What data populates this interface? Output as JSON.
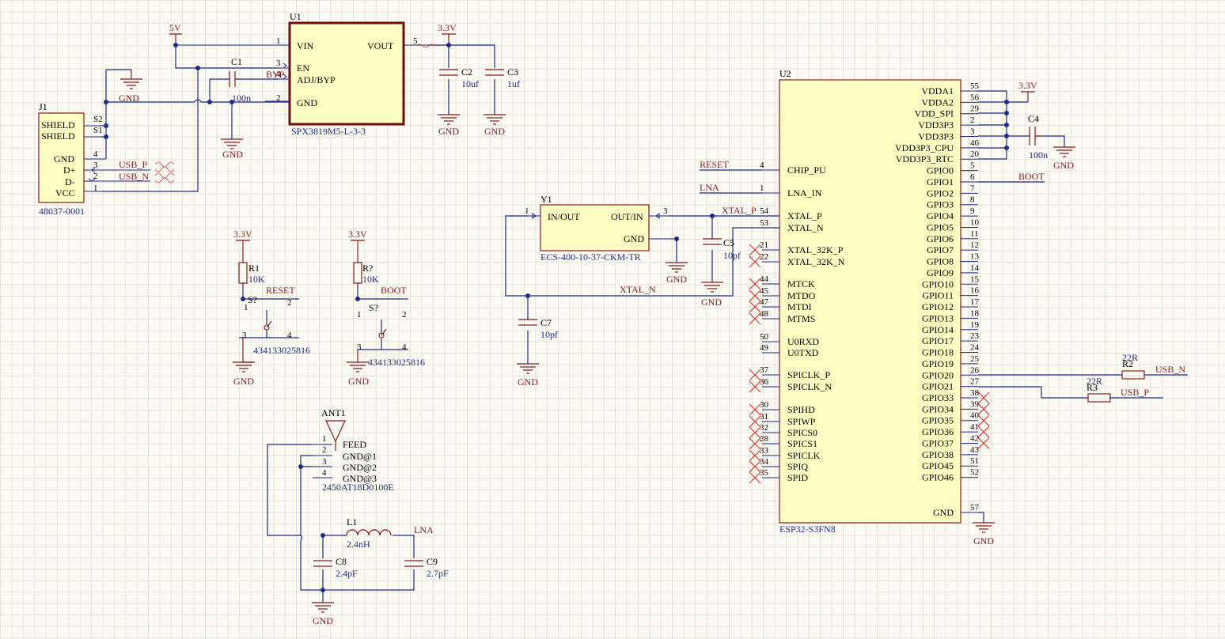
{
  "power": {
    "v5": "5V",
    "v33": "3.3V",
    "gnd": "GND"
  },
  "nets": {
    "usb_p": "USB_P",
    "usb_n": "USB_N",
    "reset": "RESET",
    "boot": "BOOT",
    "lna": "LNA",
    "xtal_p": "XTAL_P",
    "xtal_n": "XTAL_N"
  },
  "u1": {
    "ref": "U1",
    "part": "SPX3819M5-L-3-3",
    "pins": [
      "VIN",
      "EN",
      "ADJ/BYP",
      "GND",
      "VOUT"
    ],
    "nums": [
      "1",
      "3",
      "4",
      "2",
      "5"
    ],
    "byp_label": "BYP"
  },
  "c1": {
    "ref": "C1",
    "value": "100n"
  },
  "c2": {
    "ref": "C2",
    "value": "10uf"
  },
  "c3": {
    "ref": "C3",
    "value": "1uf"
  },
  "c4": {
    "ref": "C4",
    "value": "100n"
  },
  "c5": {
    "ref": "C5",
    "value": "10pf"
  },
  "c7": {
    "ref": "C7",
    "value": "10pf"
  },
  "c8": {
    "ref": "C8",
    "value": "2.4pF"
  },
  "c9": {
    "ref": "C9",
    "value": "2.7pF"
  },
  "l1": {
    "ref": "L1",
    "value": "2.4nH"
  },
  "r1": {
    "ref": "R1",
    "value": "10K"
  },
  "rq": {
    "ref": "R?",
    "value": "10K"
  },
  "r2": {
    "ref": "R2",
    "value": "22R"
  },
  "r3": {
    "ref": "R3",
    "value": "22R"
  },
  "j1": {
    "ref": "J1",
    "part": "48037-0001",
    "pins": [
      "SHIELD",
      "SHIELD",
      "GND",
      "D+",
      "D-",
      "VCC"
    ],
    "nums": [
      "S2",
      "S1",
      "4",
      "3",
      "2",
      "1"
    ]
  },
  "sw1": {
    "ref": "S?",
    "part": "434133025816",
    "nums": [
      "1",
      "2",
      "3",
      "4"
    ]
  },
  "sw2": {
    "ref": "S?",
    "part": "434133025816",
    "nums": [
      "1",
      "2",
      "3",
      "4"
    ]
  },
  "ant1": {
    "ref": "ANT1",
    "part": "2450AT18D0100E",
    "pins": [
      "FEED",
      "GND@1",
      "GND@2",
      "GND@3"
    ],
    "nums": [
      "1",
      "2",
      "3",
      "4"
    ]
  },
  "y1": {
    "ref": "Y1",
    "part": "ECS-400-10-37-CKM-TR",
    "pins": [
      "IN/OUT",
      "OUT/IN",
      "GND"
    ],
    "nums": [
      "1",
      "3"
    ]
  },
  "u2": {
    "ref": "U2",
    "part": "ESP32-S3FN8",
    "left_pins": [
      {
        "name": "CHIP_PU",
        "num": "4",
        "nc": false
      },
      {
        "name": "LNA_IN",
        "num": "1",
        "nc": false
      },
      {
        "name": "XTAL_P",
        "num": "54",
        "nc": false
      },
      {
        "name": "XTAL_N",
        "num": "53",
        "nc": false
      },
      {
        "name": "XTAL_32K_P",
        "num": "21",
        "nc": true
      },
      {
        "name": "XTAL_32K_N",
        "num": "22",
        "nc": true
      },
      {
        "name": "MTCK",
        "num": "44",
        "nc": true
      },
      {
        "name": "MTDO",
        "num": "45",
        "nc": true
      },
      {
        "name": "MTDI",
        "num": "47",
        "nc": true
      },
      {
        "name": "MTMS",
        "num": "48",
        "nc": true
      },
      {
        "name": "U0RXD",
        "num": "50",
        "nc": false
      },
      {
        "name": "U0TXD",
        "num": "49",
        "nc": false
      },
      {
        "name": "SPICLK_P",
        "num": "37",
        "nc": true
      },
      {
        "name": "SPICLK_N",
        "num": "36",
        "nc": true
      },
      {
        "name": "SPIHD",
        "num": "30",
        "nc": true
      },
      {
        "name": "SPIWP",
        "num": "31",
        "nc": true
      },
      {
        "name": "SPICS0",
        "num": "32",
        "nc": true
      },
      {
        "name": "SPICS1",
        "num": "28",
        "nc": true
      },
      {
        "name": "SPICLK",
        "num": "33",
        "nc": true
      },
      {
        "name": "SPIQ",
        "num": "34",
        "nc": true
      },
      {
        "name": "SPID",
        "num": "35",
        "nc": true
      }
    ],
    "right_pins": [
      {
        "name": "VDDA1",
        "num": "55",
        "nc": false
      },
      {
        "name": "VDDA2",
        "num": "56",
        "nc": false
      },
      {
        "name": "VDD_SPI",
        "num": "29",
        "nc": false
      },
      {
        "name": "VDD3P3",
        "num": "2",
        "nc": false
      },
      {
        "name": "VDD3P3",
        "num": "3",
        "nc": false
      },
      {
        "name": "VDD3P3_CPU",
        "num": "46",
        "nc": false
      },
      {
        "name": "VDD3P3_RTC",
        "num": "20",
        "nc": false
      },
      {
        "name": "GPIO0",
        "num": "5",
        "nc": false
      },
      {
        "name": "GPIO1",
        "num": "6",
        "nc": false
      },
      {
        "name": "GPIO2",
        "num": "7",
        "nc": false
      },
      {
        "name": "GPIO3",
        "num": "8",
        "nc": false
      },
      {
        "name": "GPIO4",
        "num": "9",
        "nc": false
      },
      {
        "name": "GPIO5",
        "num": "10",
        "nc": false
      },
      {
        "name": "GPIO6",
        "num": "11",
        "nc": false
      },
      {
        "name": "GPIO7",
        "num": "12",
        "nc": false
      },
      {
        "name": "GPIO8",
        "num": "13",
        "nc": false
      },
      {
        "name": "GPIO9",
        "num": "14",
        "nc": false
      },
      {
        "name": "GPIO10",
        "num": "15",
        "nc": false
      },
      {
        "name": "GPIO11",
        "num": "16",
        "nc": false
      },
      {
        "name": "GPIO12",
        "num": "17",
        "nc": false
      },
      {
        "name": "GPIO13",
        "num": "18",
        "nc": false
      },
      {
        "name": "GPIO14",
        "num": "19",
        "nc": false
      },
      {
        "name": "GPIO17",
        "num": "23",
        "nc": false
      },
      {
        "name": "GPIO18",
        "num": "24",
        "nc": false
      },
      {
        "name": "GPIO19",
        "num": "25",
        "nc": false
      },
      {
        "name": "GPIO20",
        "num": "26",
        "nc": false
      },
      {
        "name": "GPIO21",
        "num": "27",
        "nc": false
      },
      {
        "name": "GPIO33",
        "num": "38",
        "nc": true
      },
      {
        "name": "GPIO34",
        "num": "39",
        "nc": true
      },
      {
        "name": "GPIO35",
        "num": "40",
        "nc": true
      },
      {
        "name": "GPIO36",
        "num": "41",
        "nc": true
      },
      {
        "name": "GPIO37",
        "num": "42",
        "nc": true
      },
      {
        "name": "GPIO38",
        "num": "43",
        "nc": false
      },
      {
        "name": "GPIO45",
        "num": "51",
        "nc": false
      },
      {
        "name": "GPIO46",
        "num": "52",
        "nc": false
      },
      {
        "name": "GND",
        "num": "57",
        "nc": false
      }
    ]
  }
}
